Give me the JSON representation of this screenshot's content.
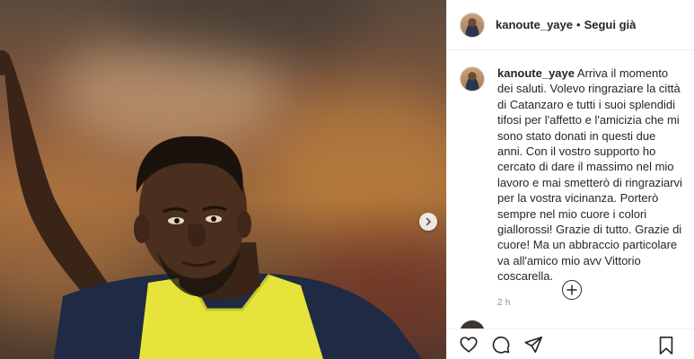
{
  "post": {
    "username": "kanoute_yaye",
    "follow_separator": "•",
    "follow_status": "Segui già",
    "caption": "Arriva il momento dei saluti. Volevo ringraziare la città di Catanzaro e tutti i suoi splendidi tifosi per l'affetto e l'amicizia che mi sono stato donati in questi due anni. Con il vostro supporto ho cercato di dare il massimo nel mio lavoro e mai smetterò di ringraziarvi per la vostra vicinanza. Porterò sempre nel mio cuore i colori giallorossi! Grazie di tutto. Grazie di cuore! Ma un abbraccio particolare va all'amico mio avv Vittorio coscarella.",
    "time_ago": "2 h"
  },
  "icons": {
    "next": "chevron-right-icon",
    "load_more": "plus-circle-icon",
    "like": "heart-icon",
    "comment": "comment-icon",
    "share": "paper-plane-icon",
    "save": "bookmark-icon"
  },
  "colors": {
    "text": "#262626",
    "secondary": "#8e8e8e",
    "divider": "#efefef",
    "bib": "#e6e43a",
    "shirt": "#1f2a44"
  }
}
